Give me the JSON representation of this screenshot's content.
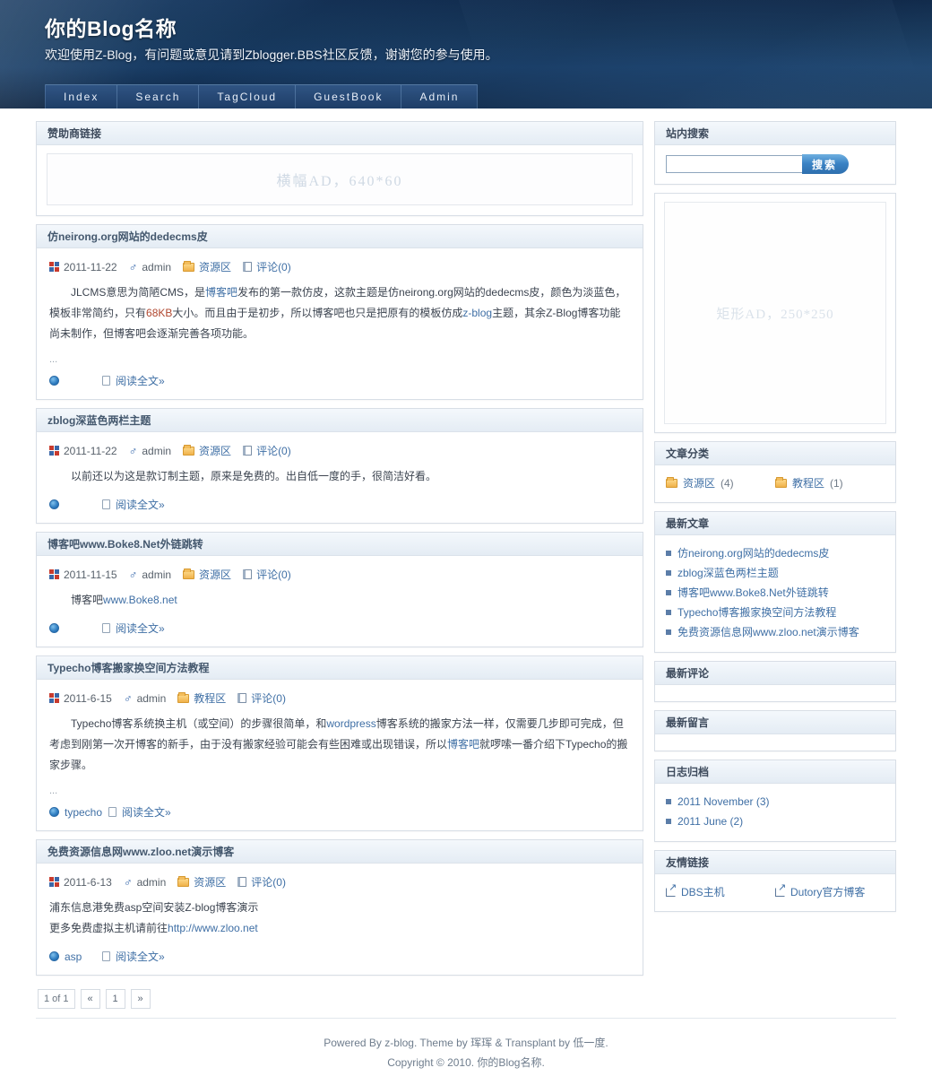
{
  "header": {
    "title": "你的Blog名称",
    "subtitle": "欢迎使用Z-Blog，有问题或意见请到Zblogger.BBS社区反馈，谢谢您的参与使用。",
    "nav": [
      {
        "label": "Index"
      },
      {
        "label": "Search"
      },
      {
        "label": "TagCloud"
      },
      {
        "label": "GuestBook"
      },
      {
        "label": "Admin"
      }
    ]
  },
  "colors": {
    "header_dark": "#0b1f3a",
    "header_mid": "#113055",
    "nav_blue": "#31568 6",
    "link": "#3f6fa5",
    "panel_head_top": "#f4f8fc",
    "panel_head_bottom": "#e4ecf4",
    "search_button": "#3a82c4",
    "highlight_red": "#b0472f"
  },
  "sponsor": {
    "heading": "赞助商链接",
    "ad_label": "横幅AD，640*60"
  },
  "articles": [
    {
      "title": "仿neirong.org网站的dedecms皮",
      "date": "2011-11-22",
      "author": "admin",
      "category": "资源区",
      "comments": "评论(0)",
      "body_parts": [
        {
          "t": "JLCMS意思为简陋CMS，是",
          "k": "text"
        },
        {
          "t": "博客吧",
          "k": "link"
        },
        {
          "t": "发布的第一款仿皮，这款主题是仿neirong.org网站的dedecms皮，颜色为淡蓝色，模板非常简约，只有",
          "k": "text"
        },
        {
          "t": "68KB",
          "k": "red"
        },
        {
          "t": "大小。而且由于是初步，所以博客吧也只是把原有的模板仿成",
          "k": "text"
        },
        {
          "t": "z-blog",
          "k": "link"
        },
        {
          "t": "主题，其余Z-Blog博客功能尚未制作，但博客吧会逐渐完善各项功能。",
          "k": "text"
        }
      ],
      "has_ellipsis": true,
      "tags": [],
      "read_more": "阅读全文»"
    },
    {
      "title": "zblog深蓝色两栏主题",
      "date": "2011-11-22",
      "author": "admin",
      "category": "资源区",
      "comments": "评论(0)",
      "body_parts": [
        {
          "t": "以前还以为这是款订制主题，原来是免费的。出自低一度的手，很简洁好看。",
          "k": "text"
        }
      ],
      "has_ellipsis": false,
      "tags": [],
      "read_more": "阅读全文»"
    },
    {
      "title": "博客吧www.Boke8.Net外链跳转",
      "date": "2011-11-15",
      "author": "admin",
      "category": "资源区",
      "comments": "评论(0)",
      "body_parts": [
        {
          "t": "博客吧",
          "k": "text"
        },
        {
          "t": "www.Boke8.net",
          "k": "link"
        }
      ],
      "has_ellipsis": false,
      "tags": [],
      "read_more": "阅读全文»"
    },
    {
      "title": "Typecho博客搬家换空间方法教程",
      "date": "2011-6-15",
      "author": "admin",
      "category": "教程区",
      "comments": "评论(0)",
      "body_parts": [
        {
          "t": "Typecho博客系统换主机（或空间）的步骤很简单，和",
          "k": "text"
        },
        {
          "t": "wordpress",
          "k": "link"
        },
        {
          "t": "博客系统的搬家方法一样，仅需要几步即可完成，但考虑到刚第一次开博客的新手，由于没有搬家经验可能会有些困难或出现错误，所以",
          "k": "text"
        },
        {
          "t": "博客吧",
          "k": "link"
        },
        {
          "t": "就啰嗦一番介绍下Typecho的搬家步骤。",
          "k": "text"
        }
      ],
      "has_ellipsis": true,
      "tags": [
        "typecho"
      ],
      "read_more": "阅读全文»"
    },
    {
      "title": "免费资源信息网www.zloo.net演示博客",
      "date": "2011-6-13",
      "author": "admin",
      "category": "资源区",
      "comments": "评论(0)",
      "body_parts": [
        {
          "t": "浦东信息港免费asp空间安装Z-blog博客演示",
          "k": "text"
        },
        {
          "t": "BR",
          "k": "br"
        },
        {
          "t": "更多免费虚拟主机请前往",
          "k": "text"
        },
        {
          "t": "http://www.zloo.net",
          "k": "link"
        }
      ],
      "has_ellipsis": false,
      "no_indent": true,
      "tags": [
        "asp"
      ],
      "read_more": "阅读全文»"
    }
  ],
  "pagination": {
    "info": "1 of 1",
    "prev": "«",
    "pages": [
      "1"
    ],
    "next": "»"
  },
  "sidebar": {
    "search": {
      "heading": "站内搜索",
      "input_value": "",
      "placeholder": "",
      "button": "搜索"
    },
    "ad": {
      "label": "矩形AD，250*250"
    },
    "categories": {
      "heading": "文章分类",
      "items": [
        {
          "label": "资源区",
          "count": "(4)"
        },
        {
          "label": "教程区",
          "count": "(1)"
        }
      ]
    },
    "recent_posts": {
      "heading": "最新文章",
      "items": [
        "仿neirong.org网站的dedecms皮",
        "zblog深蓝色两栏主题",
        "博客吧www.Boke8.Net外链跳转",
        "Typecho博客搬家换空间方法教程",
        "免费资源信息网www.zloo.net演示博客"
      ]
    },
    "recent_comments": {
      "heading": "最新评论",
      "items": []
    },
    "recent_messages": {
      "heading": "最新留言",
      "items": []
    },
    "archives": {
      "heading": "日志归档",
      "items": [
        "2011 November (3)",
        "2011 June (2)"
      ]
    },
    "friend_links": {
      "heading": "友情链接",
      "items": [
        "DBS主机",
        "Dutory官方博客"
      ]
    }
  },
  "footer": {
    "line1_prefix": "Powered By ",
    "line1_zblog": "z-blog",
    "line1_mid": ". Theme by ",
    "line1_theme_author": "珲珲",
    "line1_amp": " & Transplant by ",
    "line1_transplant_author": "低一度",
    "line1_suffix": ".",
    "line2": "Copyright © 2010. 你的Blog名称."
  }
}
